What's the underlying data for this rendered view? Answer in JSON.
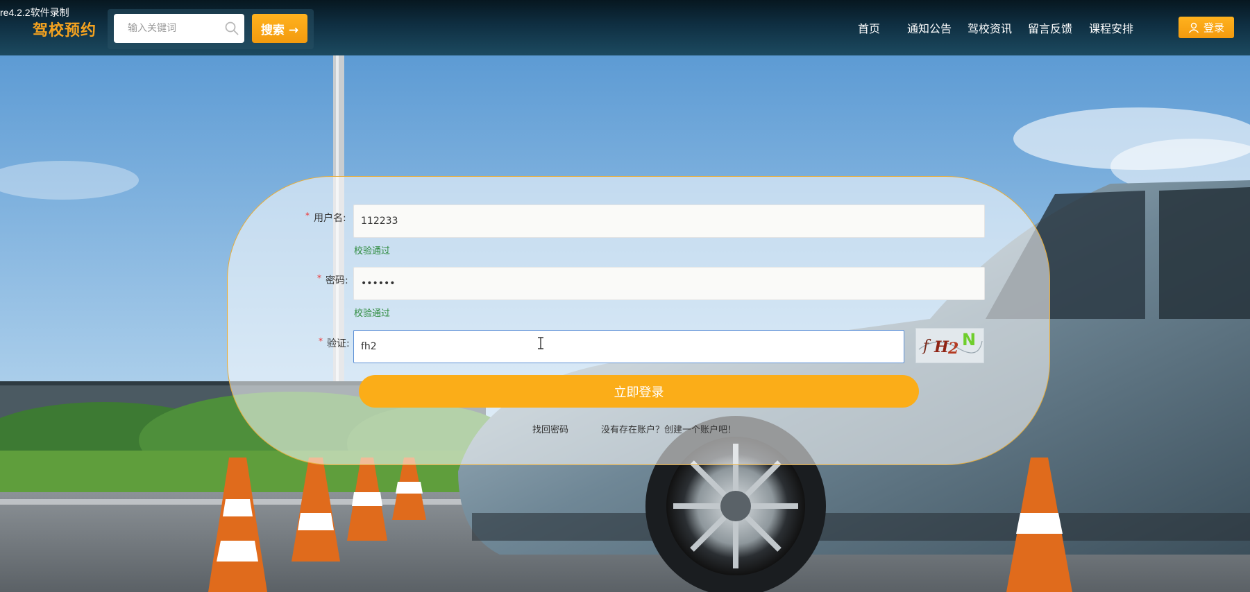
{
  "recording_watermark": "re4.2.2软件录制",
  "header": {
    "brand": "驾校预约",
    "search": {
      "placeholder": "输入关键词",
      "button_label": "搜索 →"
    },
    "nav": [
      "首页",
      "通知公告",
      "驾校资讯",
      "留言反馈",
      "课程安排"
    ],
    "login_label": "登录"
  },
  "login_form": {
    "username": {
      "label": "用户名:",
      "value": "112233",
      "hint": "校验通过"
    },
    "password": {
      "label": "密码:",
      "value": "••••••",
      "hint": "校验通过"
    },
    "captcha": {
      "label": "验证:",
      "value": "fh2",
      "image_text": "fH2N"
    },
    "submit_label": "立即登录",
    "forgot_link": "找回密码",
    "register_link": "没有存在账户？创建一个账户吧！"
  },
  "colors": {
    "accent": "#fbad18",
    "header_bg": "#0f2f42",
    "success": "#2e8b3e",
    "required": "#ee3333"
  }
}
